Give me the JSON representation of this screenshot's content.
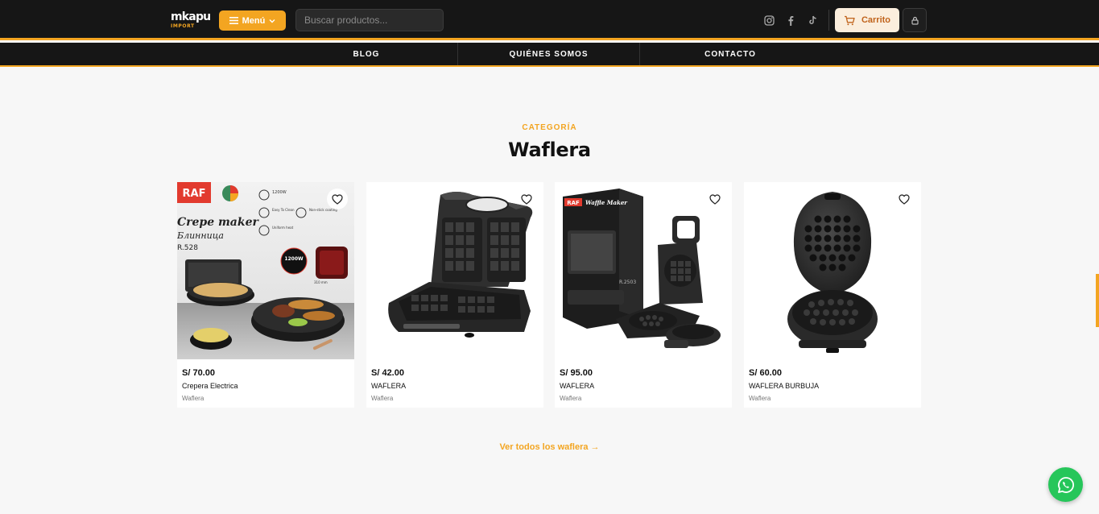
{
  "brand": {
    "name": "mkapu",
    "sub": "IMPORT",
    "accent": "#f3a521",
    "dark": "#161616"
  },
  "header": {
    "menu_label": "Menú",
    "search_placeholder": "Buscar productos...",
    "social": [
      "instagram-icon",
      "facebook-icon",
      "tiktok-icon"
    ],
    "cart_label": "Carrito"
  },
  "nav": {
    "items": [
      {
        "label": "BLOG"
      },
      {
        "label": "QUIÉNES SOMOS"
      },
      {
        "label": "CONTACTO"
      }
    ]
  },
  "section": {
    "eyebrow": "CATEGORÍA",
    "title": "Waflera"
  },
  "products": [
    {
      "price": "S/ 70.00",
      "name": "Crepera Electrica",
      "category": "Waflera",
      "img_text": {
        "brand": "RAF",
        "title": "Crepe maker",
        "subtitle": "Блинница",
        "model": "R.528",
        "watt": "1200W",
        "spec1": "1200W",
        "spec2": "Easy To Clean",
        "spec3": "Non-stick coating",
        "spec4": "Uniform heat",
        "size": "310 mm"
      }
    },
    {
      "price": "S/ 42.00",
      "name": "WAFLERA",
      "category": "Waflera"
    },
    {
      "price": "S/ 95.00",
      "name": "WAFLERA",
      "category": "Waflera",
      "img_text": {
        "brand": "RAF",
        "box_title": "Waffle Maker",
        "model": "R.2503"
      }
    },
    {
      "price": "S/ 60.00",
      "name": "WAFLERA BURBUJA",
      "category": "Waflera"
    }
  ],
  "view_all": "Ver todos los waflera →"
}
